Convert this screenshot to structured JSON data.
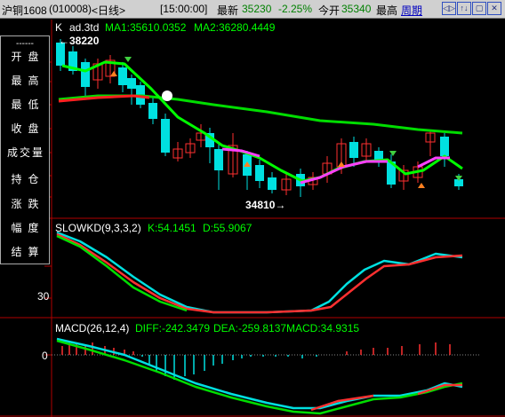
{
  "titlebar": {
    "instrument": "沪铜1608",
    "code": "(010008)",
    "period": "<日线>",
    "time": "[15:00:00]",
    "latest_label": "最新",
    "latest_value": "35230",
    "change_pct": "-2.25%",
    "open_label": "今开",
    "open_value": "35340",
    "high_label": "最高",
    "link": "周期",
    "buttons": [
      "◁▷",
      "↑↓",
      "▢",
      "✕"
    ]
  },
  "side_panel": {
    "dash": "------",
    "items": [
      "开盘",
      "最高",
      "最低",
      "收盘",
      "成交量",
      "持仓",
      "涨跌",
      "幅度",
      "结算"
    ]
  },
  "main_chart": {
    "header": {
      "k_label": "K",
      "name": "ad.3td",
      "ma1": "MA1:35610.0352",
      "ma2": "MA2:36280.4449"
    },
    "high_annot": "←38220",
    "low_annot": "34810→"
  },
  "kd_chart": {
    "header": {
      "name": "SLOWKD(9,3,3,2)",
      "k": "K:54.1451",
      "d": "D:55.9067"
    },
    "y_tick": "30"
  },
  "macd_chart": {
    "header": {
      "name": "MACD(26,12,4)",
      "diff": "DIFF:-242.3479",
      "dea": "DEA:-259.8137",
      "macd": "MACD:34.9315"
    },
    "y_tick": "0"
  },
  "colors": {
    "up": "#ff3030",
    "down": "#00e0e0",
    "ma1": "#00ff00",
    "ma1_alt": "#ff40ff",
    "ma2_green": "#00dd00",
    "ma2_red": "#ff2020",
    "kd_k": "#00e0e0",
    "kd_d": "#ff3030"
  }
}
